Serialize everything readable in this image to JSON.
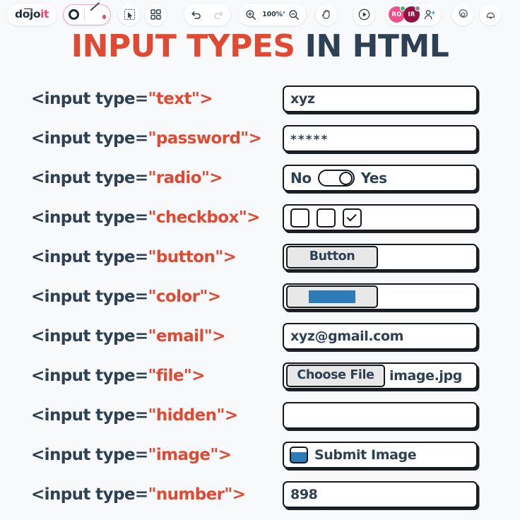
{
  "toolbar": {
    "logo": {
      "prefix": "d",
      "mid": "ojo",
      "accent": "it",
      "full": "dojoit"
    },
    "tools": {
      "shape_tool": "shape-ring-tool",
      "pen_tool": "pen-line-tool",
      "select_tool": "select-cursor-tool",
      "frame_tool": "frame-grid-tool"
    },
    "history": {
      "undo": "undo",
      "redo": "redo"
    },
    "zoom": {
      "zoom_in": "zoom-in",
      "level": "100%",
      "zoom_out": "zoom-out"
    },
    "hand": "hand-pan-tool",
    "present": "present-play",
    "collaborators": [
      {
        "initials": "RO",
        "color": "#f2508b",
        "status": "online",
        "status_color": "#2fc46a"
      },
      {
        "initials": "IR",
        "color": "#93123f",
        "status": "away",
        "status_color": "#8b8b8b"
      }
    ],
    "invite": "invite-user",
    "settings": "settings",
    "notifications": "notifications"
  },
  "title": {
    "main": "INPUT TYPES",
    "sub": "IN HTML",
    "main_color": "#e04a33",
    "sub_color": "#2e4054"
  },
  "colors": {
    "red": "#e04a33",
    "navy": "#2e4054",
    "blue": "#2d7cb8",
    "ink": "#15191d",
    "gray_button": "#e8e8e8",
    "background": "#f8f9fa"
  },
  "rows": [
    {
      "code_prefix": "<input type=",
      "code_value": "\"text\">",
      "type": "text",
      "field_kind": "text",
      "value": "xyz"
    },
    {
      "code_prefix": "<input type=",
      "code_value": "\"password\">",
      "type": "password",
      "field_kind": "password",
      "value": "*****"
    },
    {
      "code_prefix": "<input type=",
      "code_value": "\"radio\">",
      "type": "radio",
      "field_kind": "toggle",
      "label_left": "No",
      "label_right": "Yes",
      "toggle_on": true
    },
    {
      "code_prefix": "<input type=",
      "code_value": "\"checkbox\">",
      "type": "checkbox",
      "field_kind": "checkboxes",
      "checkboxes": [
        false,
        false,
        true
      ]
    },
    {
      "code_prefix": "<input type=",
      "code_value": "\"button\">",
      "type": "button",
      "field_kind": "button",
      "button_label": "Button"
    },
    {
      "code_prefix": "<input type=",
      "code_value": "\"color\">",
      "type": "color",
      "field_kind": "color",
      "swatch_color": "#2d7cb8"
    },
    {
      "code_prefix": "<input type=",
      "code_value": "\"email\">",
      "type": "email",
      "field_kind": "text",
      "value": "xyz@gmail.com"
    },
    {
      "code_prefix": "<input type=",
      "code_value": "\"file\">",
      "type": "file",
      "field_kind": "file",
      "button_label": "Choose File",
      "file_name": "image.jpg"
    },
    {
      "code_prefix": "<input type=",
      "code_value": "\"hidden\">",
      "type": "hidden",
      "field_kind": "empty",
      "value": ""
    },
    {
      "code_prefix": "<input type=",
      "code_value": "\"image\">",
      "type": "image",
      "field_kind": "image",
      "image_label": "Submit Image"
    },
    {
      "code_prefix": "<input type=",
      "code_value": "\"number\">",
      "type": "number",
      "field_kind": "text",
      "value": "898"
    }
  ]
}
